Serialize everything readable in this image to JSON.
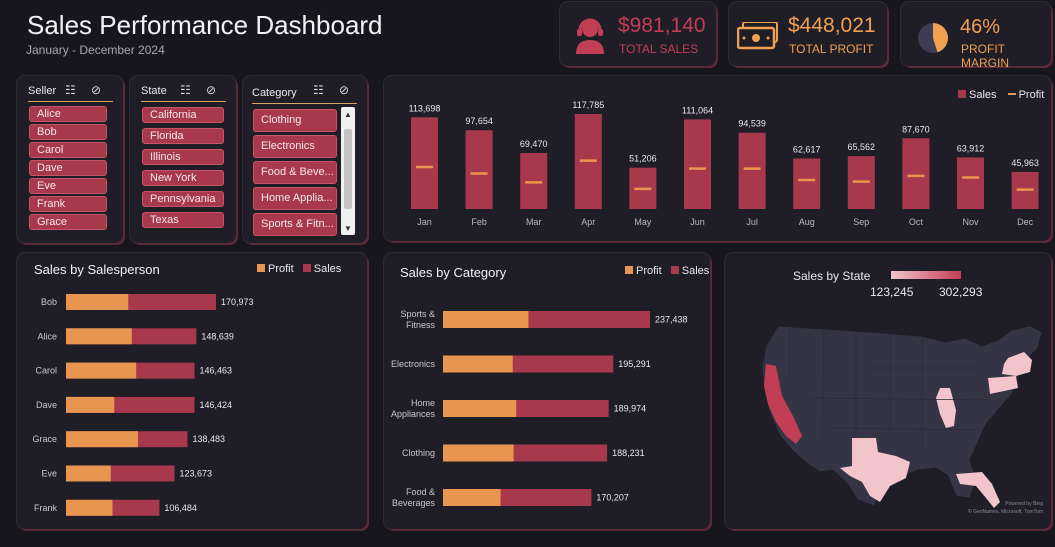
{
  "header": {
    "title": "Sales Performance Dashboard",
    "subtitle": "January - December 2024"
  },
  "kpis": {
    "total_sales": {
      "value": "$981,140",
      "label": "TOTAL SALES",
      "color": "#c23e55",
      "icon": "headset-agent-icon"
    },
    "total_profit": {
      "value": "$448,021",
      "label": "TOTAL PROFIT",
      "color": "#f0a050",
      "icon": "money-bill-icon"
    },
    "profit_margin": {
      "value": "46%",
      "label": "PROFIT MARGIN",
      "color": "#f0a050",
      "icon": "pie-chart-icon"
    }
  },
  "slicers": {
    "seller": {
      "label": "Seller",
      "items": [
        "Alice",
        "Bob",
        "Carol",
        "Dave",
        "Eve",
        "Frank",
        "Grace"
      ]
    },
    "state": {
      "label": "State",
      "items": [
        "California",
        "Florida",
        "Illinois",
        "New York",
        "Pennsylvania",
        "Texas"
      ]
    },
    "category": {
      "label": "Category",
      "items": [
        "Clothing",
        "Electronics",
        "Food & Beve...",
        "Home Applia...",
        "Sports & Fitn..."
      ]
    }
  },
  "colors": {
    "sales": "#a8384b",
    "profit": "#e8964f",
    "panel": "#1f1e27",
    "map_base": "#353445",
    "map_low": "#f2c4cc",
    "map_high": "#c23e55"
  },
  "chart_data": [
    {
      "type": "bar",
      "title": "",
      "categories": [
        "Jan",
        "Feb",
        "Mar",
        "Apr",
        "May",
        "Jun",
        "Jul",
        "Aug",
        "Sep",
        "Oct",
        "Nov",
        "Dec"
      ],
      "series": [
        {
          "name": "Sales",
          "values": [
            113698,
            97654,
            69470,
            117785,
            51206,
            111064,
            94539,
            62617,
            65562,
            87670,
            63912,
            45963
          ]
        },
        {
          "name": "Profit",
          "values": [
            52000,
            44000,
            33000,
            60000,
            25000,
            50000,
            50000,
            36000,
            34000,
            41000,
            39000,
            24000
          ]
        }
      ],
      "data_labels": [
        "113,698",
        "97,654",
        "69,470",
        "117,785",
        "51,206",
        "111,064",
        "94,539",
        "62,617",
        "65,562",
        "87,670",
        "63,912",
        "45,963"
      ],
      "legend": [
        "Sales",
        "Profit"
      ],
      "legend_position": "top-right"
    },
    {
      "type": "bar",
      "orientation": "horizontal",
      "title": "Sales by Salesperson",
      "categories": [
        "Bob",
        "Alice",
        "Carol",
        "Dave",
        "Grace",
        "Eve",
        "Frank"
      ],
      "series": [
        {
          "name": "Profit",
          "values": [
            71000,
            75000,
            80000,
            55000,
            82000,
            51000,
            53000
          ]
        },
        {
          "name": "Sales",
          "values": [
            170973,
            148639,
            146463,
            146424,
            138483,
            123673,
            106484
          ]
        }
      ],
      "data_labels": [
        "170,973",
        "148,639",
        "146,463",
        "146,424",
        "138,483",
        "123,673",
        "106,484"
      ],
      "legend": [
        "Profit",
        "Sales"
      ],
      "legend_position": "top-right"
    },
    {
      "type": "bar",
      "orientation": "horizontal",
      "title": "Sales by Category",
      "categories": [
        "Sports & Fitness",
        "Electronics",
        "Home Appliances",
        "Clothing",
        "Food & Beverages"
      ],
      "category_lines": [
        [
          "Sports &",
          "Fitness"
        ],
        [
          "Electronics"
        ],
        [
          "Home",
          "Appliances"
        ],
        [
          "Clothing"
        ],
        [
          "Food &",
          "Beverages"
        ]
      ],
      "series": [
        {
          "name": "Profit",
          "values": [
            98000,
            80000,
            84000,
            81000,
            66000
          ]
        },
        {
          "name": "Sales",
          "values": [
            237438,
            195291,
            189974,
            188231,
            170207
          ]
        }
      ],
      "data_labels": [
        "237,438",
        "195,291",
        "189,974",
        "188,231",
        "170,207"
      ],
      "legend": [
        "Profit",
        "Sales"
      ],
      "legend_position": "top-right"
    },
    {
      "type": "map",
      "title": "Sales by State",
      "scale_min": "123,245",
      "scale_max": "302,293",
      "highlighted_states": [
        "California",
        "Texas",
        "Illinois",
        "Florida",
        "New York",
        "Pennsylvania"
      ],
      "attribution": [
        "Powered by Bing",
        "© GeoNames, Microsoft, TomTom"
      ]
    }
  ]
}
